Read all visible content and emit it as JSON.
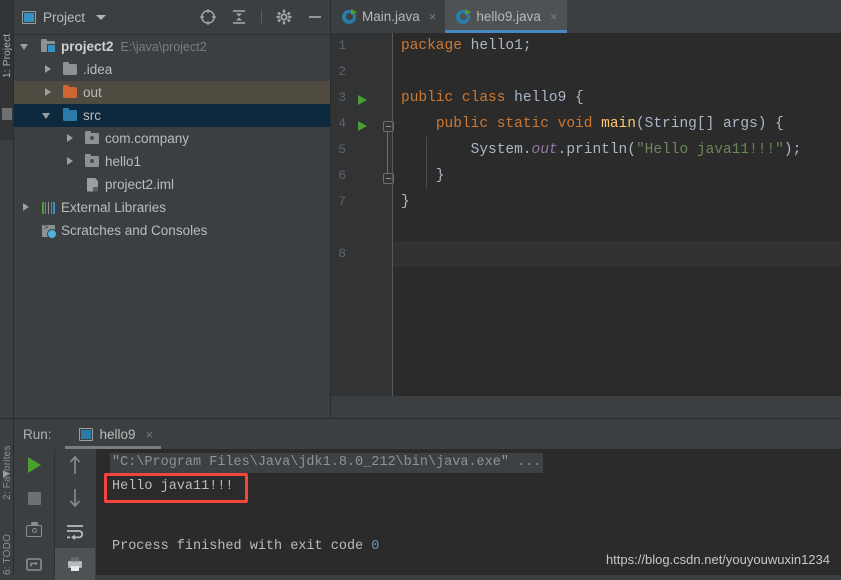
{
  "left_rail": {
    "segments": [
      "1: Project",
      "2: Favorites",
      "6: TODO"
    ],
    "marker_icon": "panel-marker-icon"
  },
  "project_panel": {
    "title": "Project",
    "title_icon": "project-window-icon",
    "dropdown_icon": "chevron-down-icon",
    "actions": [
      {
        "name": "select-opened-file-icon",
        "label": "locate"
      },
      {
        "name": "collapse-all-icon",
        "label": "collapse all"
      },
      {
        "name": "gear-icon",
        "label": "settings"
      },
      {
        "name": "minimize-icon",
        "label": "hide"
      }
    ],
    "tree": [
      {
        "label": "project2",
        "sub": "E:\\java\\project2",
        "icon": "module-folder-icon",
        "indent": 0,
        "arrow": "down",
        "state": "normal",
        "bold": true
      },
      {
        "label": ".idea",
        "sub": "",
        "icon": "folder-gray-icon",
        "indent": 1,
        "arrow": "right",
        "state": "normal",
        "bold": false
      },
      {
        "label": "out",
        "sub": "",
        "icon": "folder-orange-icon",
        "indent": 1,
        "arrow": "right",
        "state": "hover",
        "bold": false
      },
      {
        "label": "src",
        "sub": "",
        "icon": "folder-blue-icon",
        "indent": 1,
        "arrow": "down",
        "state": "selected",
        "bold": false
      },
      {
        "label": "com.company",
        "sub": "",
        "icon": "package-icon",
        "indent": 2,
        "arrow": "right",
        "state": "normal",
        "bold": false
      },
      {
        "label": "hello1",
        "sub": "",
        "icon": "package-icon",
        "indent": 2,
        "arrow": "right",
        "state": "normal",
        "bold": false
      },
      {
        "label": "project2.iml",
        "sub": "",
        "icon": "iml-file-icon",
        "indent": 2,
        "arrow": "none",
        "state": "normal",
        "bold": false
      },
      {
        "label": "External Libraries",
        "sub": "",
        "icon": "libraries-icon",
        "indent": 0,
        "arrow": "right",
        "state": "normal",
        "bold": false
      },
      {
        "label": "Scratches and Consoles",
        "sub": "",
        "icon": "scratches-icon",
        "indent": 0,
        "arrow": "none",
        "state": "normal",
        "bold": false
      }
    ]
  },
  "editor": {
    "tabs": [
      {
        "label": "Main.java",
        "icon": "java-class-icon",
        "active": false,
        "close_glyph": "×"
      },
      {
        "label": "hello9.java",
        "icon": "java-class-icon",
        "active": true,
        "close_glyph": "×"
      }
    ],
    "line_numbers": [
      "1",
      "2",
      "3",
      "4",
      "5",
      "6",
      "7",
      "8"
    ],
    "current_line": 8,
    "run_gutter_lines": [
      3,
      4
    ],
    "fold_lines": [
      4,
      6
    ],
    "code_lines": [
      {
        "n": 1,
        "tokens": [
          {
            "t": "package ",
            "c": "kw"
          },
          {
            "t": "hello1;",
            "c": "pl"
          }
        ]
      },
      {
        "n": 2,
        "tokens": []
      },
      {
        "n": 3,
        "tokens": [
          {
            "t": "public class ",
            "c": "kw"
          },
          {
            "t": "hello9 {",
            "c": "pl"
          }
        ]
      },
      {
        "n": 4,
        "tokens": [
          {
            "t": "    ",
            "c": "pl"
          },
          {
            "t": "public static void ",
            "c": "kw"
          },
          {
            "t": "main",
            "c": "fn"
          },
          {
            "t": "(String[] args) {",
            "c": "pl"
          }
        ]
      },
      {
        "n": 5,
        "tokens": [
          {
            "t": "        System.",
            "c": "pl"
          },
          {
            "t": "out",
            "c": "fld"
          },
          {
            "t": ".println(",
            "c": "pl"
          },
          {
            "t": "\"Hello java11!!!\"",
            "c": "str"
          },
          {
            "t": ");",
            "c": "pl"
          }
        ]
      },
      {
        "n": 6,
        "tokens": [
          {
            "t": "    }",
            "c": "pl"
          }
        ]
      },
      {
        "n": 7,
        "tokens": [
          {
            "t": "}",
            "c": "pl"
          }
        ]
      },
      {
        "n": 8,
        "tokens": []
      }
    ]
  },
  "run_panel": {
    "label": "Run:",
    "tab_label": "hello9",
    "tab_icon": "run-configuration-icon",
    "tab_close_glyph": "×",
    "toolbar_left": [
      {
        "name": "rerun-icon",
        "label": "Rerun"
      },
      {
        "name": "stop-icon",
        "label": "Stop"
      },
      {
        "name": "camera-icon",
        "label": "Dump Threads"
      },
      {
        "name": "restore-layout-icon",
        "label": "Restore Layout"
      }
    ],
    "toolbar_right": [
      {
        "name": "arrow-up-icon",
        "label": "Up"
      },
      {
        "name": "arrow-down-icon",
        "label": "Down"
      },
      {
        "name": "soft-wrap-icon",
        "label": "Soft-Wrap"
      },
      {
        "name": "print-icon",
        "label": "Print"
      }
    ],
    "console": {
      "command": "\"C:\\Program Files\\Java\\jdk1.8.0_212\\bin\\java.exe\" ...",
      "output": "Hello java11!!!",
      "finish_prefix": "Process finished with exit code ",
      "exit_code": "0",
      "highlight_color": "#f2453d"
    }
  },
  "watermark": "https://blog.csdn.net/youyouwuxin1234"
}
